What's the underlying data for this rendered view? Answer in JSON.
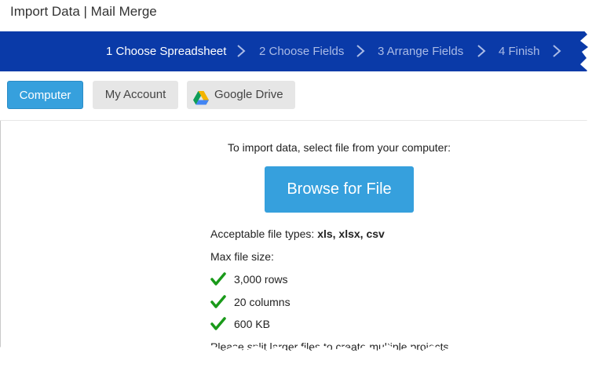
{
  "window": {
    "title": "Import Data | Mail Merge"
  },
  "steps": [
    {
      "label": "1 Choose Spreadsheet",
      "active": true
    },
    {
      "label": "2 Choose Fields",
      "active": false
    },
    {
      "label": "3 Arrange Fields",
      "active": false
    },
    {
      "label": "4 Finish",
      "active": false
    }
  ],
  "tabs": {
    "computer": "Computer",
    "account": "My Account",
    "drive": "Google Drive"
  },
  "main": {
    "instruction": "To import data, select file from your computer:",
    "browse_label": "Browse for File",
    "file_types_label": "Acceptable file types:",
    "file_types_value": "xls, xlsx, csv",
    "max_size_label": "Max file size:",
    "limits": [
      "3,000 rows",
      "20 columns",
      "600 KB"
    ],
    "note": "Please split larger files to create multiple projects."
  },
  "colors": {
    "step_bar": "#0a3aa8",
    "accent": "#36a0dd",
    "check": "#1a9a1a"
  },
  "icons": [
    "chevron-right-icon",
    "google-drive-icon",
    "checkmark-icon"
  ]
}
